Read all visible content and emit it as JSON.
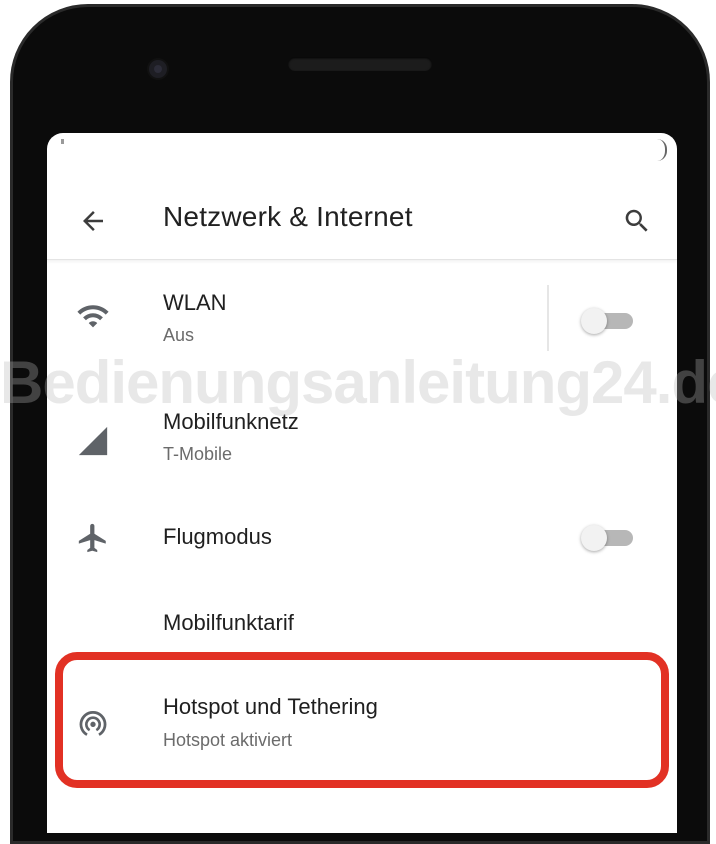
{
  "header": {
    "title": "Netzwerk & Internet",
    "back_icon": "arrow-back-icon",
    "search_icon": "search-icon"
  },
  "settings": {
    "wlan": {
      "title": "WLAN",
      "subtitle": "Aus",
      "icon": "wifi-icon",
      "toggle_on": false
    },
    "mobile": {
      "title": "Mobilfunknetz",
      "subtitle": "T-Mobile",
      "icon": "signal-icon"
    },
    "airplane": {
      "title": "Flugmodus",
      "icon": "airplane-icon",
      "toggle_on": false
    },
    "plan": {
      "title": "Mobilfunktarif"
    },
    "hotspot": {
      "title": "Hotspot und Tethering",
      "subtitle": "Hotspot aktiviert",
      "icon": "hotspot-icon",
      "highlighted": true
    }
  },
  "watermark": "Bedienungsanleitung24.de",
  "colors": {
    "highlight": "#e23124",
    "icon": "#5f6368",
    "text": "#202020"
  }
}
